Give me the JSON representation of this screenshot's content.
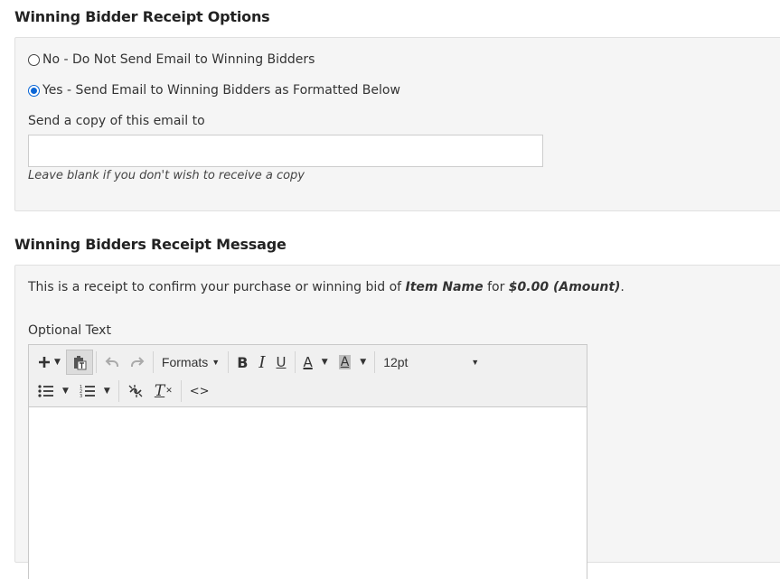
{
  "receipt_options": {
    "title": "Winning Bidder Receipt Options",
    "option_no": "No - Do Not Send Email to Winning Bidders",
    "option_yes": "Yes - Send Email to Winning Bidders as Formatted Below",
    "copy_label": "Send a copy of this email to",
    "copy_value": "",
    "copy_hint": "Leave blank if you don't wish to receive a copy",
    "selected": "yes"
  },
  "receipt_message": {
    "title": "Winning Bidders Receipt Message",
    "text_prefix": "This is a receipt to confirm your purchase or winning bid of",
    "item_name": "Item Name",
    "text_for": "for",
    "amount": "$0.00 (Amount)",
    "text_end": ".",
    "optional_label": "Optional Text"
  },
  "editor": {
    "toolbar": {
      "insert_icon": "plus-icon",
      "paste_icon": "paste-text-icon",
      "undo_icon": "undo-icon",
      "redo_icon": "redo-icon",
      "formats_label": "Formats",
      "bold_label": "B",
      "italic_label": "I",
      "underline_label": "U",
      "text_color_label": "A",
      "bg_color_label": "A",
      "font_size": "12pt",
      "bullet_list_icon": "bullet-list-icon",
      "numbered_list_icon": "numbered-list-icon",
      "unlink_icon": "unlink-icon",
      "clear_format_label": "T",
      "code_label": "<>"
    },
    "content": ""
  }
}
